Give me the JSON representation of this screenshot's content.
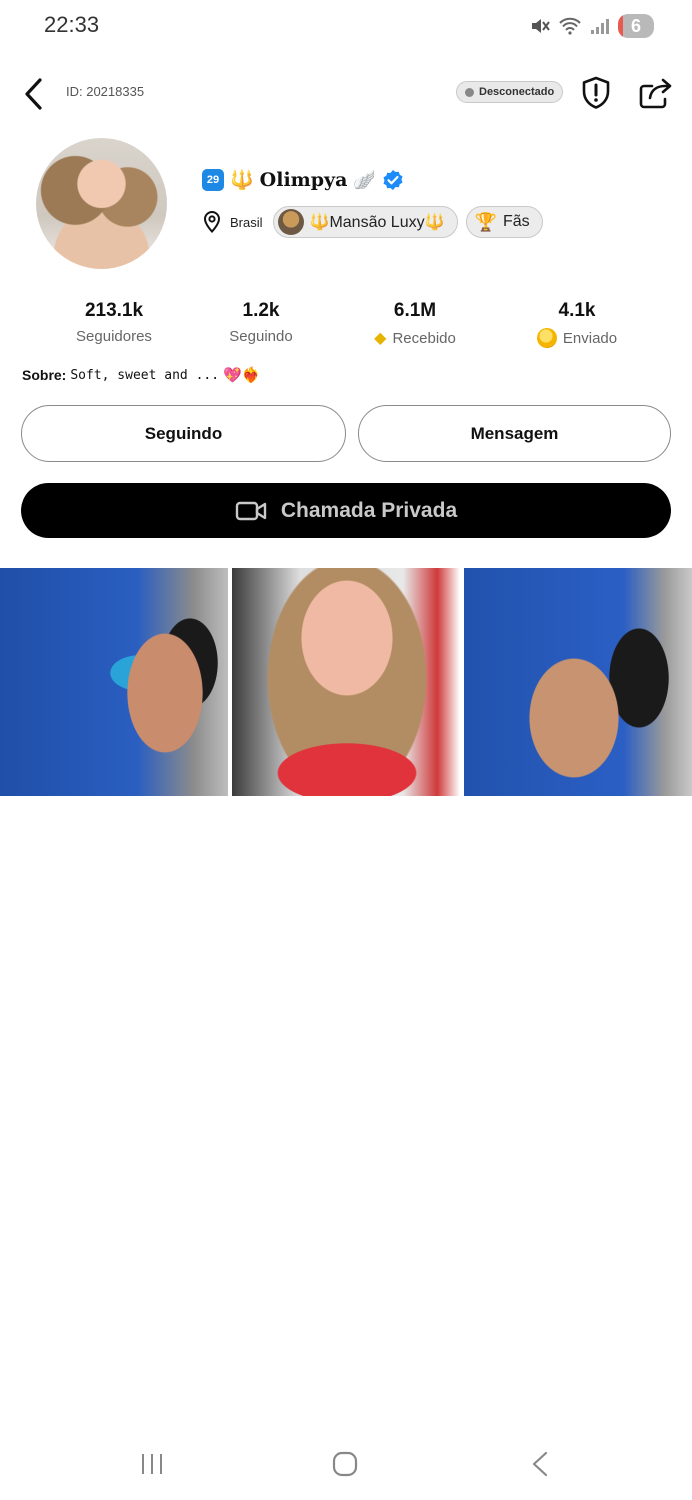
{
  "status_bar": {
    "time": "22:33",
    "battery_level": "6"
  },
  "header": {
    "user_id": "ID: 20218335",
    "connection_status": "Desconectado"
  },
  "profile": {
    "level": "29",
    "name_prefix": "🔱",
    "name": "Olimpya",
    "name_suffix": "🪽",
    "country": "Brasil",
    "family_chip": "🔱Mansão Luxy🔱",
    "fans_chip": "Fãs"
  },
  "stats": [
    {
      "value": "213.1k",
      "label": "Seguidores"
    },
    {
      "value": "1.2k",
      "label": "Seguindo"
    },
    {
      "value": "6.1M",
      "label": "Recebido"
    },
    {
      "value": "4.1k",
      "label": "Enviado"
    }
  ],
  "about": {
    "label": "Sobre:",
    "text": "Soft, sweet and ...",
    "emoji": "💖❤️‍🔥"
  },
  "actions": {
    "following_label": "Seguindo",
    "message_label": "Mensagem",
    "private_call_label": "Chamada Privada"
  },
  "gallery": [
    {
      "icon": "photo-pool-bikini"
    },
    {
      "icon": "photo-selfie"
    },
    {
      "icon": "photo-pool-bikini-2"
    }
  ],
  "colors": {
    "verified": "#1d8cf8",
    "level_badge": "#1e88e5",
    "call_button_bg": "#000000",
    "trident": "#e0a400"
  }
}
